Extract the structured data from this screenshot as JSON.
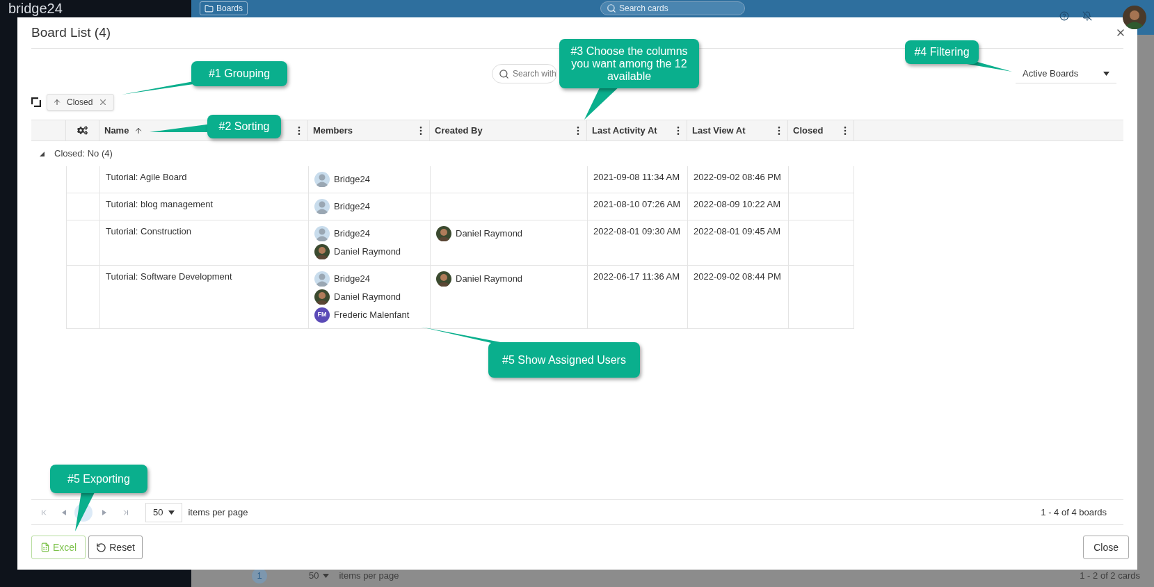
{
  "background": {
    "logo": "bridge24",
    "boards_button": "Boards",
    "search": {
      "placeholder": "Search cards"
    },
    "pager": {
      "page": "1",
      "page_size": "50",
      "per_page_label": "items per page",
      "summary": "1 - 2 of 2 cards"
    }
  },
  "dialog": {
    "title": "Board List (4)",
    "search": {
      "placeholder": "Search with"
    },
    "filter": {
      "value": "Active Boards"
    },
    "grouping": [
      {
        "label": "Closed"
      }
    ],
    "columns": [
      {
        "label": "Name",
        "sorted": true
      },
      {
        "label": "Members",
        "sorted": false
      },
      {
        "label": "Created By",
        "sorted": false
      },
      {
        "label": "Last Activity At",
        "sorted": false
      },
      {
        "label": "Last View At",
        "sorted": false
      },
      {
        "label": "Closed",
        "sorted": false
      }
    ],
    "groups": [
      {
        "label": "Closed: No (4)",
        "expanded": true,
        "rows": [
          {
            "name": "Tutorial: Agile Board",
            "members": [
              {
                "name": "Bridge24",
                "kind": "default"
              }
            ],
            "last_activity": "2021-09-08 11:34 AM",
            "last_view": "2022-09-02 08:46 PM"
          },
          {
            "name": "Tutorial: blog management",
            "members": [
              {
                "name": "Bridge24",
                "kind": "default"
              }
            ],
            "last_activity": "2021-08-10 07:26 AM",
            "last_view": "2022-08-09 10:22 AM"
          },
          {
            "name": "Tutorial: Construction",
            "members": [
              {
                "name": "Bridge24",
                "kind": "default"
              },
              {
                "name": "Daniel Raymond",
                "kind": "photo"
              }
            ],
            "created_by": {
              "name": "Daniel Raymond",
              "kind": "photo"
            },
            "last_activity": "2022-08-01 09:30 AM",
            "last_view": "2022-08-01 09:45 AM"
          },
          {
            "name": "Tutorial: Software Development",
            "members": [
              {
                "name": "Bridge24",
                "kind": "default"
              },
              {
                "name": "Daniel Raymond",
                "kind": "photo"
              },
              {
                "name": "Frederic Malenfant",
                "kind": "initials",
                "initials": "FM",
                "color": "#5b4bb7"
              }
            ],
            "created_by": {
              "name": "Daniel Raymond",
              "kind": "photo"
            },
            "last_activity": "2022-06-17 11:36 AM",
            "last_view": "2022-09-02 08:44 PM"
          }
        ]
      }
    ],
    "pager": {
      "page_size": "50",
      "per_page_label": "items per page",
      "summary": "1 - 4 of 4 boards"
    },
    "buttons": [
      {
        "label": "Excel",
        "kind": "excel"
      },
      {
        "label": "Reset",
        "kind": "reset"
      }
    ],
    "close_button": "Close"
  },
  "callouts": [
    {
      "text": "#1 Grouping"
    },
    {
      "text": "#2 Sorting"
    },
    {
      "text": "#3 Choose the columns you want among the 12 available"
    },
    {
      "text": "#4 Filtering"
    },
    {
      "text": "#5 Show Assigned Users"
    },
    {
      "text": "#5 Exporting"
    }
  ]
}
